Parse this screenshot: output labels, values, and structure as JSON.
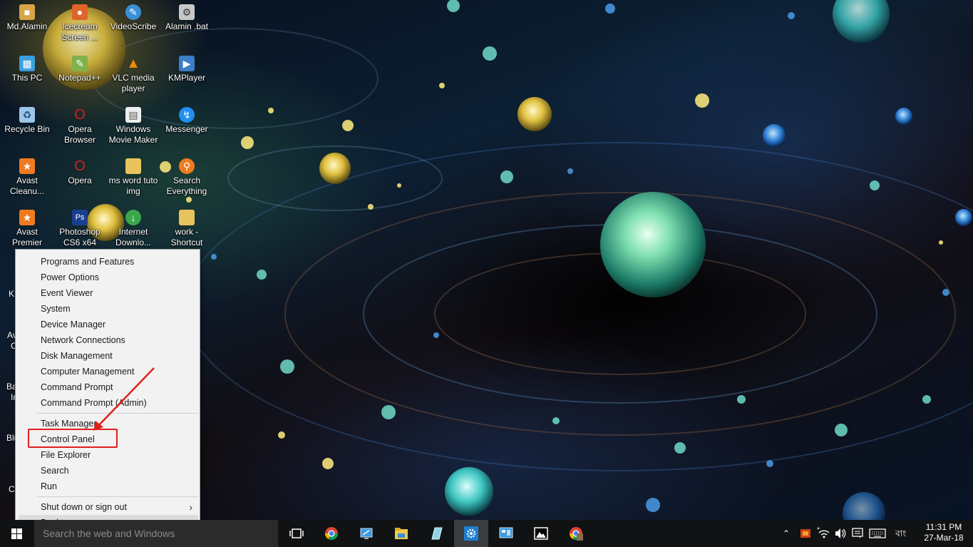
{
  "desktop": {
    "icons": [
      {
        "label": "Md.Alamin",
        "icon": "user-folder-icon",
        "color": "#d7a548"
      },
      {
        "label": "Icecream Screen ...",
        "icon": "icecream-recorder-icon",
        "color": "#e0632a"
      },
      {
        "label": "VideoScribe",
        "icon": "videoscribe-icon",
        "color": "#3a8fd6"
      },
      {
        "label": "Alamin .bat",
        "icon": "batch-file-icon",
        "color": "#c8c8c8"
      },
      {
        "label": "This PC",
        "icon": "computer-icon",
        "color": "#3aa0e0"
      },
      {
        "label": "Notepad++",
        "icon": "notepad-plus-icon",
        "color": "#7fb24a"
      },
      {
        "label": "VLC media player",
        "icon": "vlc-cone-icon",
        "color": "#f08a00"
      },
      {
        "label": "KMPlayer",
        "icon": "kmplayer-icon",
        "color": "#3a7fc8"
      },
      {
        "label": "Recycle Bin",
        "icon": "recycle-bin-icon",
        "color": "#9cc6e8"
      },
      {
        "label": "Opera Browser",
        "icon": "opera-icon",
        "color": "#d42020"
      },
      {
        "label": "Windows Movie Maker",
        "icon": "document-icon",
        "color": "#eeeeee"
      },
      {
        "label": "Messenger",
        "icon": "messenger-icon",
        "color": "#1f8ef1"
      },
      {
        "label": "Avast Cleanu...",
        "icon": "avast-cleanup-icon",
        "color": "#f07a20"
      },
      {
        "label": "Opera",
        "icon": "opera-icon",
        "color": "#d42020"
      },
      {
        "label": "ms word tuto img",
        "icon": "folder-icon",
        "color": "#e8c25a"
      },
      {
        "label": "Search Everything",
        "icon": "search-everything-icon",
        "color": "#f07a20"
      },
      {
        "label": "Avast Premier",
        "icon": "avast-icon",
        "color": "#f07a20"
      },
      {
        "label": "Photoshop CS6 x64",
        "icon": "photoshop-icon",
        "color": "#1b3f8f"
      },
      {
        "label": "Internet Downlo...",
        "icon": "internet-download-manager-icon",
        "color": "#3aa84a"
      },
      {
        "label": "work - Shortcut",
        "icon": "folder-shortcut-icon",
        "color": "#e8c25a"
      }
    ],
    "partial_labels": [
      "K",
      "Av",
      "C",
      "Ba",
      "In",
      "Blu",
      "C"
    ]
  },
  "context_menu": {
    "group1": [
      "Programs and Features",
      "Power Options",
      "Event Viewer",
      "System",
      "Device Manager",
      "Network Connections",
      "Disk Management",
      "Computer Management",
      "Command Prompt",
      "Command Prompt (Admin)"
    ],
    "group2": [
      "Task Manager",
      "Control Panel",
      "File Explorer",
      "Search",
      "Run"
    ],
    "group3": {
      "shutdown": "Shut down or sign out",
      "desktop": "Desktop"
    },
    "highlighted_item": "Control Panel",
    "highlight_color": "#e0201c"
  },
  "taskbar": {
    "search_placeholder": "Search the web and Windows",
    "apps": [
      "task-view-icon",
      "chrome-icon",
      "remote-desktop-icon",
      "file-explorer-icon",
      "notes-app-icon",
      "settings-gear-icon",
      "control-panel-icon",
      "photos-icon",
      "chrome-profile-icon"
    ],
    "tray": {
      "language": "বাং",
      "time": "11:31 PM",
      "date": "27-Mar-18"
    }
  }
}
